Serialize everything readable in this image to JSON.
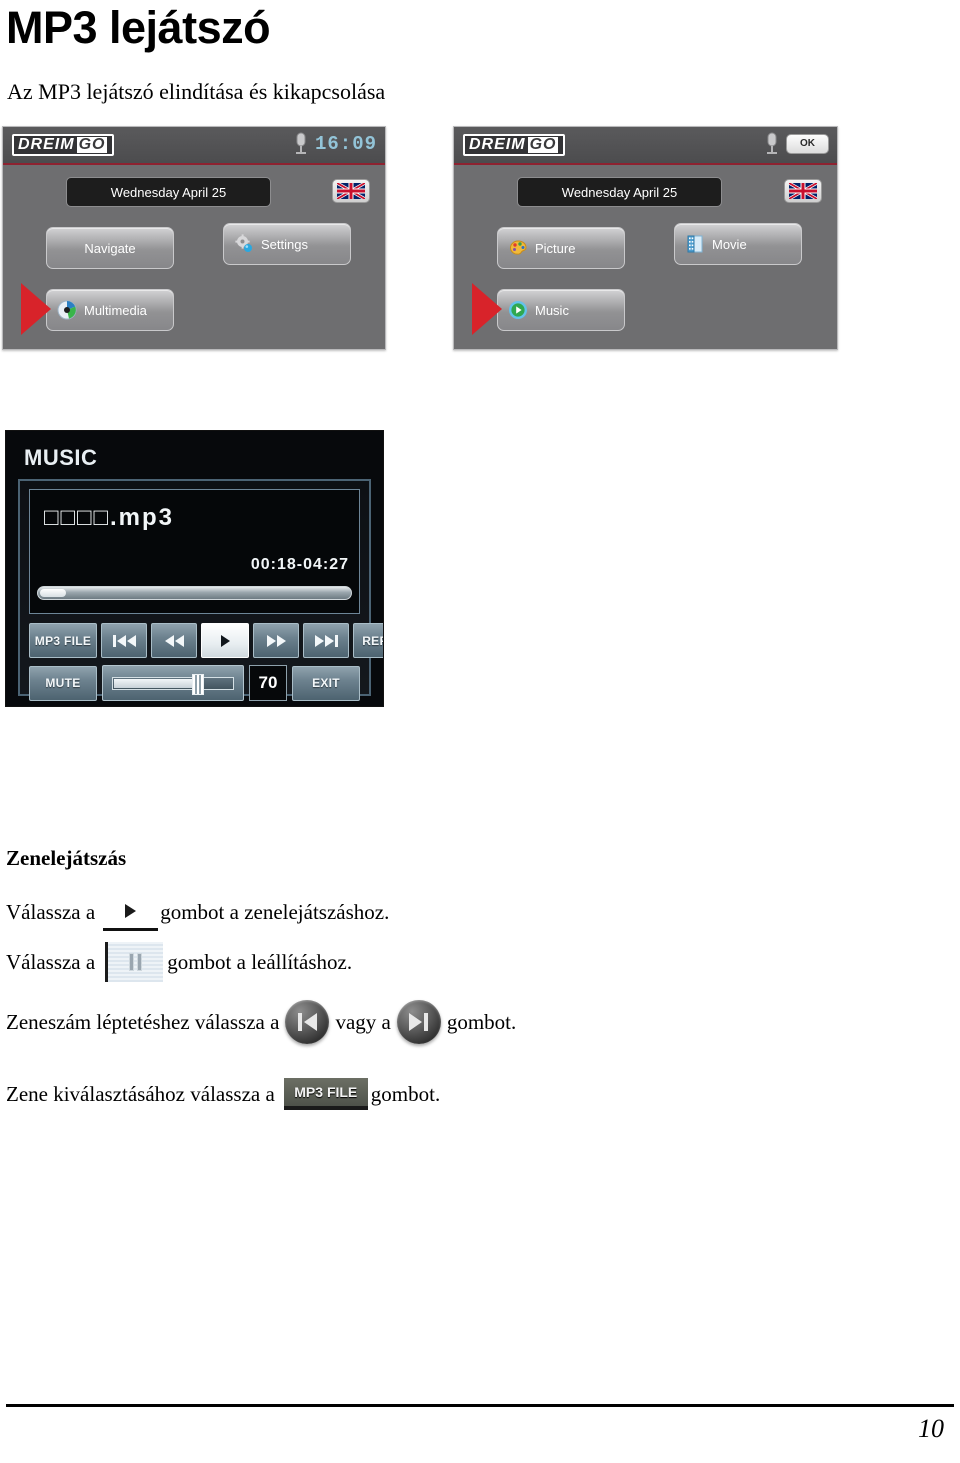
{
  "document": {
    "title": "MP3 lejátszó",
    "subtitle": "Az MP3 lejátszó elindítása és kikapcsolása",
    "page_number": "10"
  },
  "device_multimedia": {
    "logo_main": "DREIM",
    "logo_suffix": "GO",
    "clock": "16:09",
    "date": "Wednesday April 25",
    "flag": "uk-flag-icon",
    "buttons": [
      {
        "label": "Navigate",
        "icon": ""
      },
      {
        "label": "Settings",
        "icon": "gear-icon"
      },
      {
        "label": "Multimedia",
        "icon": "disc-icon"
      }
    ],
    "pointer": "red-arrow-pointing-multimedia"
  },
  "device_media": {
    "logo_main": "DREIM",
    "logo_suffix": "GO",
    "ok_label": "OK",
    "date": "Wednesday April 25",
    "flag": "uk-flag-icon",
    "buttons": [
      {
        "label": "Picture",
        "icon": "palette-icon"
      },
      {
        "label": "Movie",
        "icon": "film-icon"
      },
      {
        "label": "Music",
        "icon": "play-circle-icon"
      }
    ],
    "pointer": "red-arrow-pointing-music"
  },
  "mp3_player": {
    "title": "MUSIC",
    "track_name": "□□□□.mp3",
    "time": "00:18-04:27",
    "progress_percent": 7,
    "transport": [
      {
        "label": "MP3 FILE",
        "icon": ""
      },
      {
        "label": "",
        "icon": "previous-track-icon"
      },
      {
        "label": "",
        "icon": "rewind-icon"
      },
      {
        "label": "",
        "icon": "play-icon"
      },
      {
        "label": "",
        "icon": "fast-forward-icon"
      },
      {
        "label": "",
        "icon": "next-track-icon"
      },
      {
        "label": "REPEAT",
        "icon": ""
      }
    ],
    "mute_label": "MUTE",
    "volume_value": "70",
    "volume_percent": 68,
    "exit_label": "EXIT"
  },
  "instructions": {
    "heading": "Zenelejátszás",
    "play_before": "Válassza a",
    "play_after": "gombot a zenelejátszáshoz.",
    "pause_before": "Válassza a",
    "pause_after": "gombot a leállításhoz.",
    "skip_before": "Zeneszám léptetéshez válassza a",
    "skip_middle": "vagy a",
    "skip_after": "gombot.",
    "select_before": "Zene kiválasztásához válassza a",
    "select_button_label": "MP3 FILE",
    "select_after": "gombot."
  },
  "colors": {
    "accent_red": "#d8232a",
    "device_bg": "#6e6e70",
    "clock_cyan": "#93c4d8"
  }
}
